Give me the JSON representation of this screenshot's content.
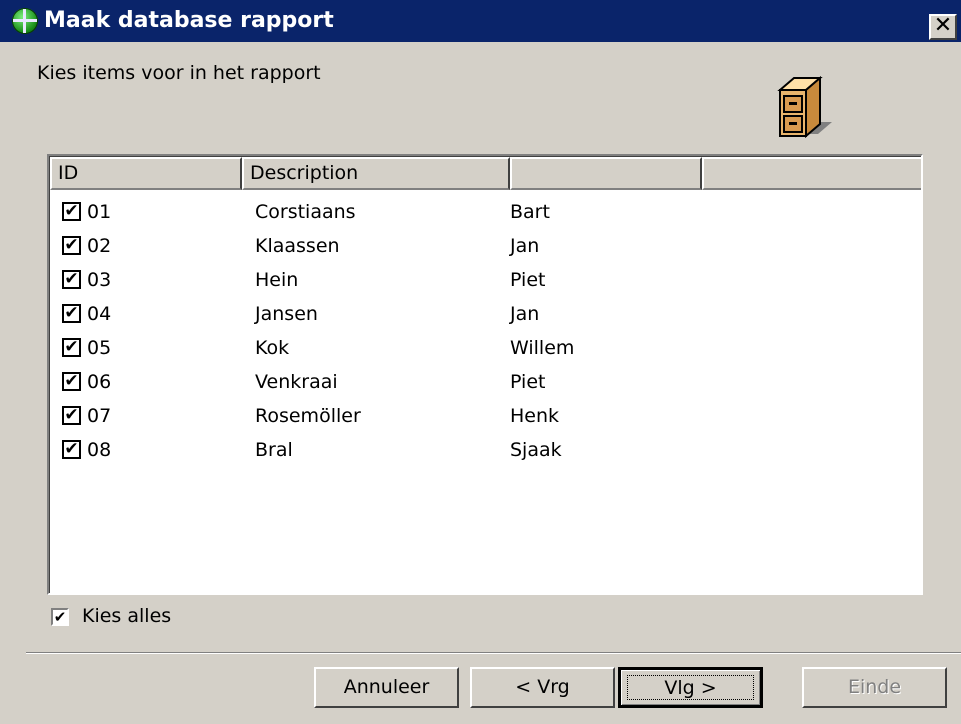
{
  "window": {
    "title": "Maak database rapport",
    "close_glyph": "✕"
  },
  "subtitle": "Kies items voor in het rapport",
  "list": {
    "columns": [
      "ID",
      "Description",
      "",
      ""
    ],
    "rows": [
      {
        "checked": true,
        "id": "01",
        "description": "Corstiaans",
        "name": "Bart"
      },
      {
        "checked": true,
        "id": "02",
        "description": "Klaassen",
        "name": "Jan"
      },
      {
        "checked": true,
        "id": "03",
        "description": "Hein",
        "name": "Piet"
      },
      {
        "checked": true,
        "id": "04",
        "description": "Jansen",
        "name": "Jan"
      },
      {
        "checked": true,
        "id": "05",
        "description": "Kok",
        "name": "Willem"
      },
      {
        "checked": true,
        "id": "06",
        "description": "Venkraai",
        "name": "Piet"
      },
      {
        "checked": true,
        "id": "07",
        "description": "Rosemöller",
        "name": "Henk"
      },
      {
        "checked": true,
        "id": "08",
        "description": "Bral",
        "name": "Sjaak"
      }
    ]
  },
  "select_all": {
    "label": "Kies alles",
    "checked": true
  },
  "buttons": {
    "cancel": "Annuleer",
    "back": "< Vrg",
    "next": "Vlg >",
    "finish": "Einde"
  },
  "icons": {
    "app": "globe-icon",
    "header": "filing-cabinet-icon",
    "check": "✔"
  },
  "colors": {
    "titlebar": "#0a246a",
    "face": "#d4d0c8"
  }
}
